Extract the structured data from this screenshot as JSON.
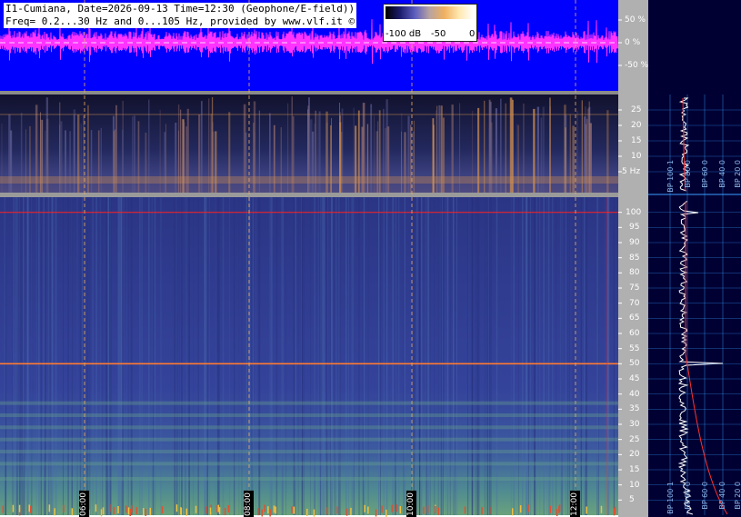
{
  "header": {
    "line1": "I1-Cumiana, Date=2026-09-13 Time=12:30 (Geophone/E-field))",
    "line2": "Freq= 0.2...30 Hz and 0...105 Hz, provided by www.vlf.it ©"
  },
  "colorbar": {
    "labels": [
      "-100 dB",
      "-50",
      "0"
    ],
    "stops": [
      "#000000",
      "#1c1c6e",
      "#5e5ec0",
      "#b8a3a0",
      "#f0b060",
      "#ffe8b0",
      "#ffffff"
    ]
  },
  "waveform_axis": {
    "labels": [
      "50 %",
      "0 %",
      "-50 %"
    ]
  },
  "low_freq_axis": {
    "labels": [
      "25",
      "20",
      "15",
      "10",
      "5 Hz"
    ],
    "values": [
      25,
      20,
      15,
      10,
      5
    ],
    "range": [
      0,
      30
    ]
  },
  "high_freq_axis": {
    "labels": [
      "100",
      "95",
      "90",
      "85",
      "80",
      "75",
      "70",
      "65",
      "60",
      "55",
      "50",
      "45",
      "40",
      "35",
      "30",
      "25",
      "20",
      "15",
      "10",
      "5"
    ],
    "values": [
      100,
      95,
      90,
      85,
      80,
      75,
      70,
      65,
      60,
      55,
      50,
      45,
      40,
      35,
      30,
      25,
      20,
      15,
      10,
      5
    ],
    "range": [
      0,
      105
    ]
  },
  "time_axis": {
    "labels": [
      "06:00",
      "08:00",
      "10:00",
      "12:00"
    ]
  },
  "spectrum_low_labels": [
    "BP 100 1",
    "BP 80 0",
    "BP 60 0",
    "BP 40 0",
    "BP 20 0"
  ],
  "spectrum_high_labels": [
    "BP 100 1",
    "BP 80 0",
    "BP 60 0",
    "BP 40 0",
    "BP 20 0"
  ],
  "colors": {
    "waveform_bg": "#0000ff",
    "waveform_trace": "#ff33ff",
    "spectro_dark": "#1a1a44",
    "spectro_mid": "#2f3a8a",
    "hum_line": "#ff7a30",
    "ref_line": "#ff2020",
    "axis_bg": "#b0b0b0",
    "right_panel_bg": "#000033",
    "grid": "#3aa0ff"
  }
}
